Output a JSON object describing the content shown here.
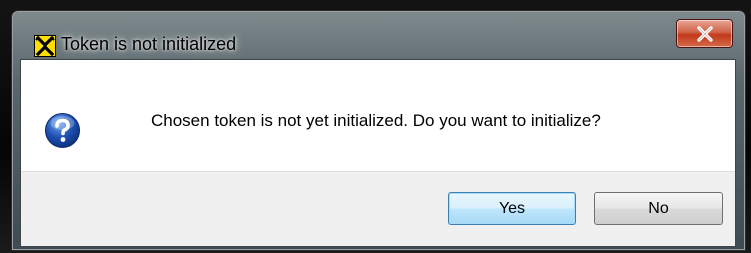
{
  "dialog": {
    "title": "Token is not initialized",
    "message": "Chosen token is not yet initialized. Do you want to initialize?",
    "icons": {
      "app": "raiffeisen-cross-logo-icon",
      "message": "question-icon",
      "close": "close-icon"
    }
  },
  "buttons": {
    "yes_label": "Yes",
    "no_label": "No"
  },
  "colors": {
    "app_icon_background": "#ffde00",
    "close_button": "#c2391b",
    "question_icon": "#1d4fb0",
    "default_button_border": "#3c7fb1"
  }
}
